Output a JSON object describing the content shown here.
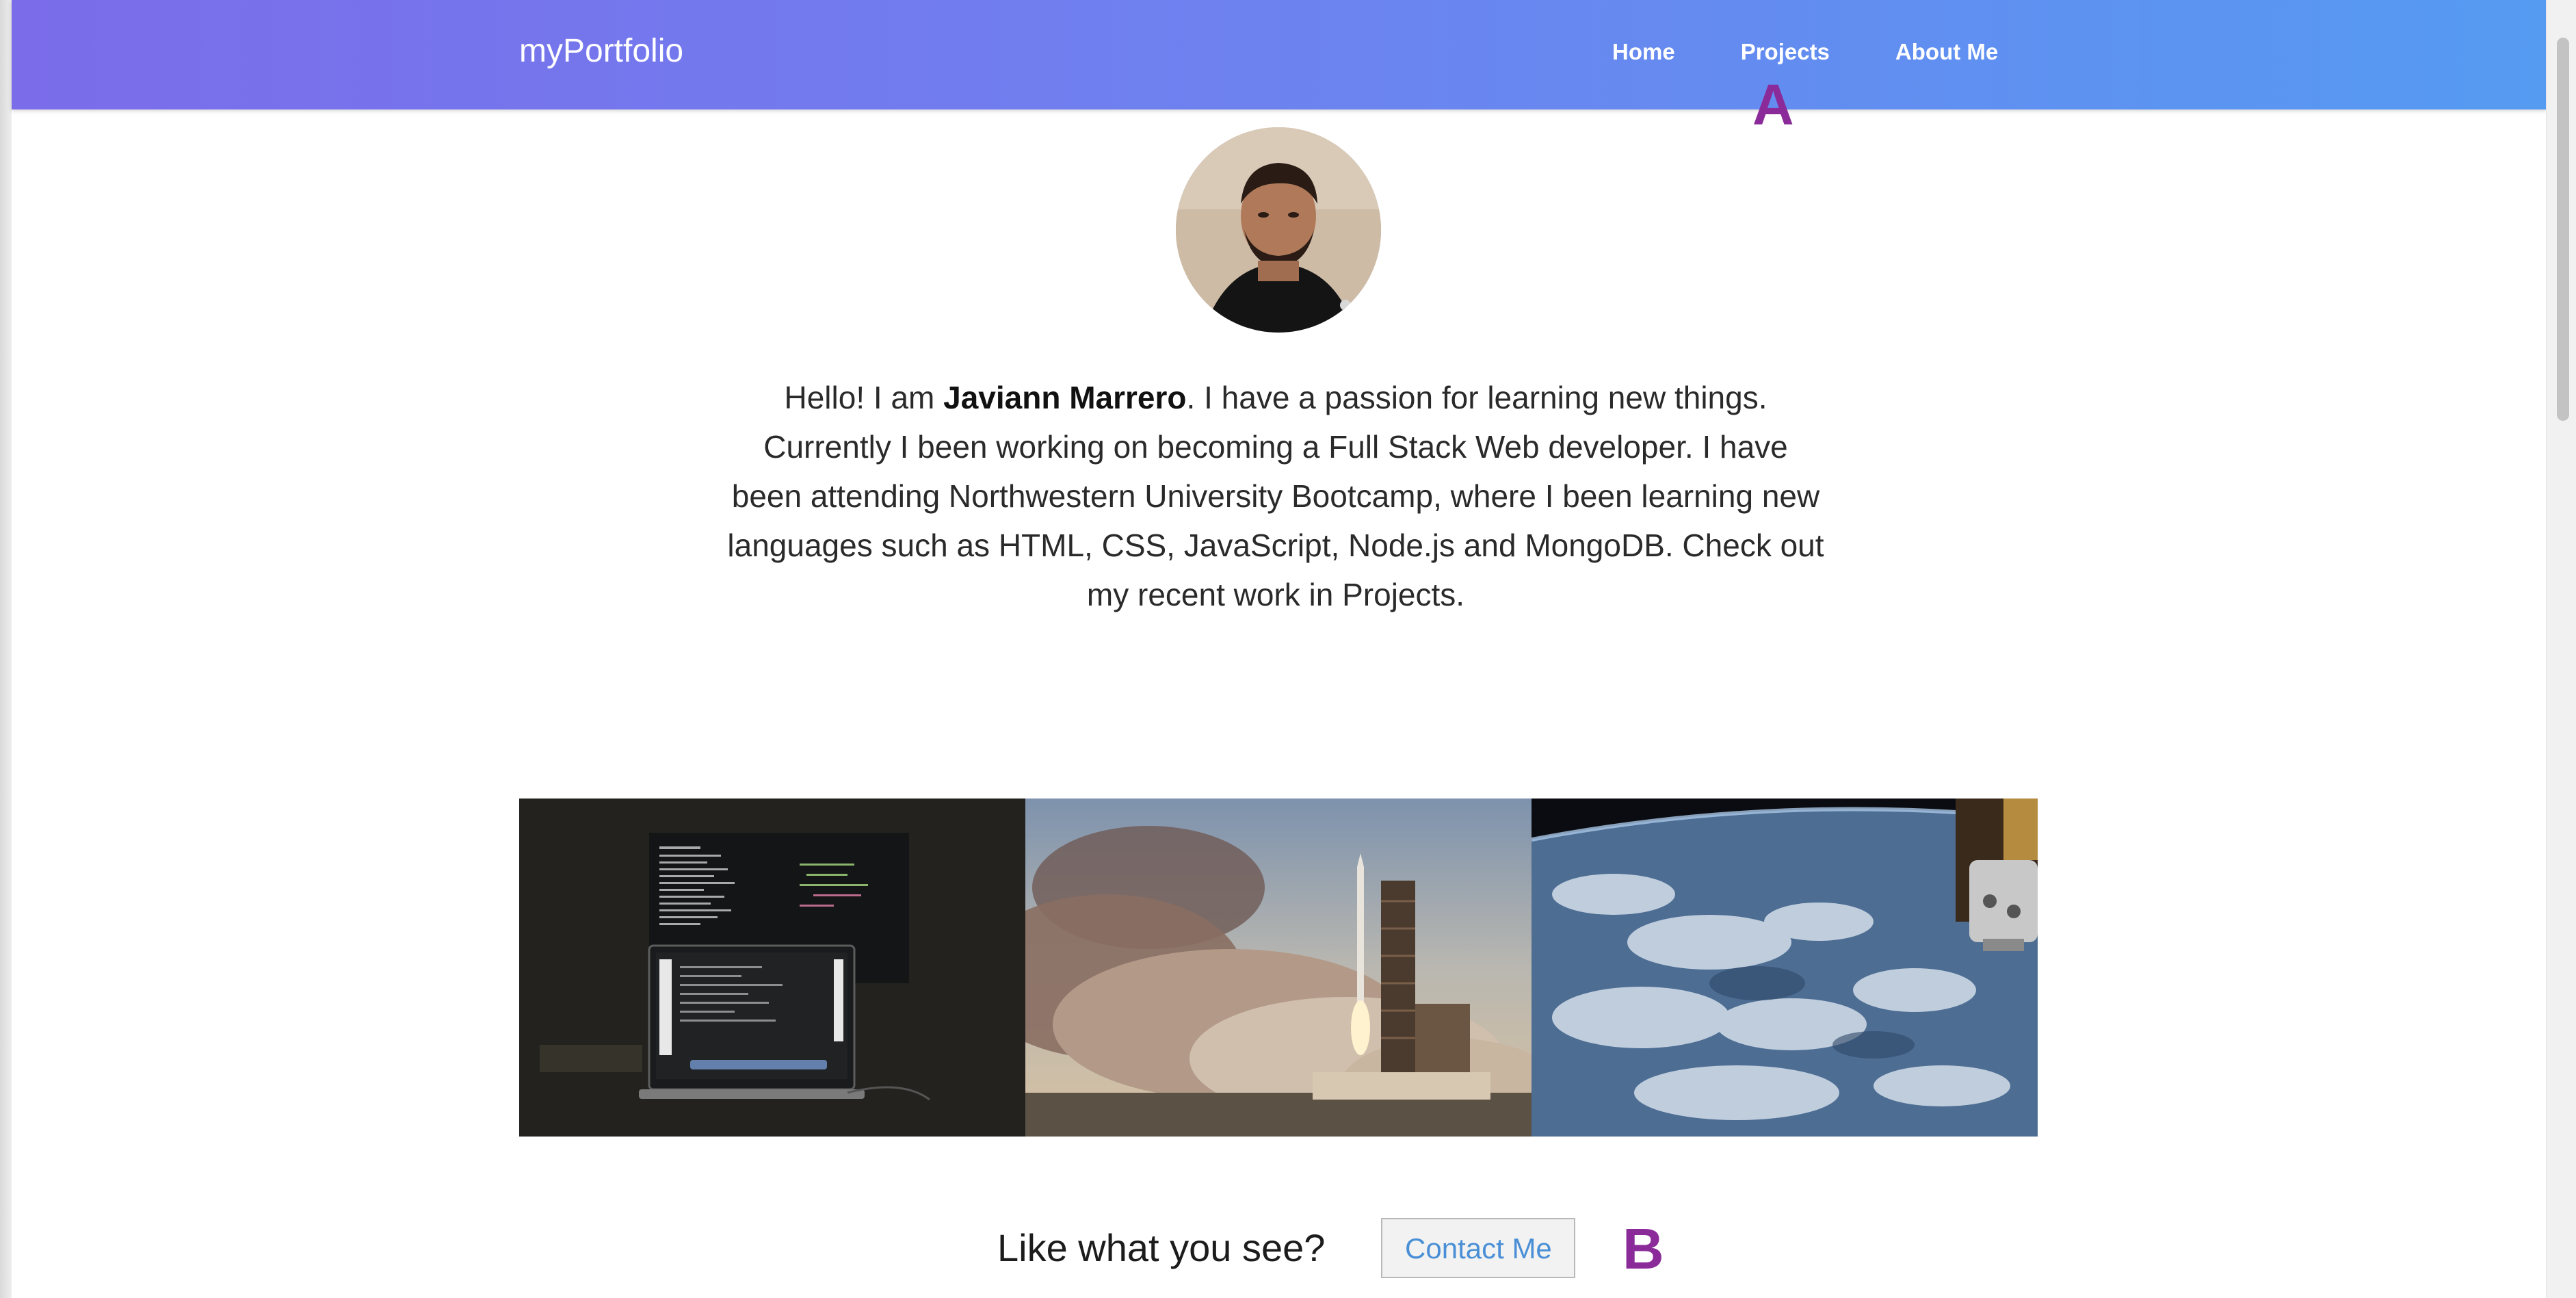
{
  "navbar": {
    "brand": "myPortfolio",
    "links": [
      "Home",
      "Projects",
      "About Me"
    ]
  },
  "annotations": {
    "a": "A",
    "b": "B"
  },
  "profile": {
    "alt": "Profile photo of Javiann Marrero"
  },
  "intro": {
    "before_name": "Hello! I am ",
    "name": "Javiann Marrero",
    "after_name": ". I have a passion for learning new things. Currently I been working on becoming a Full Stack Web developer. I have been attending Northwestern University Bootcamp, where I been learning new languages such as HTML, CSS, JavaScript, Node.js and MongoDB. Check out my recent work in Projects."
  },
  "gallery": {
    "images": [
      "laptop-code-photo",
      "rocket-launch-photo",
      "earth-from-space-photo"
    ]
  },
  "cta": {
    "text": "Like what you see?",
    "button": "Contact Me"
  },
  "colors": {
    "nav_gradient_start": "#7b6cea",
    "nav_gradient_end": "#559bf2",
    "marker": "#8b2b9a",
    "button_text": "#4a8fd6"
  }
}
